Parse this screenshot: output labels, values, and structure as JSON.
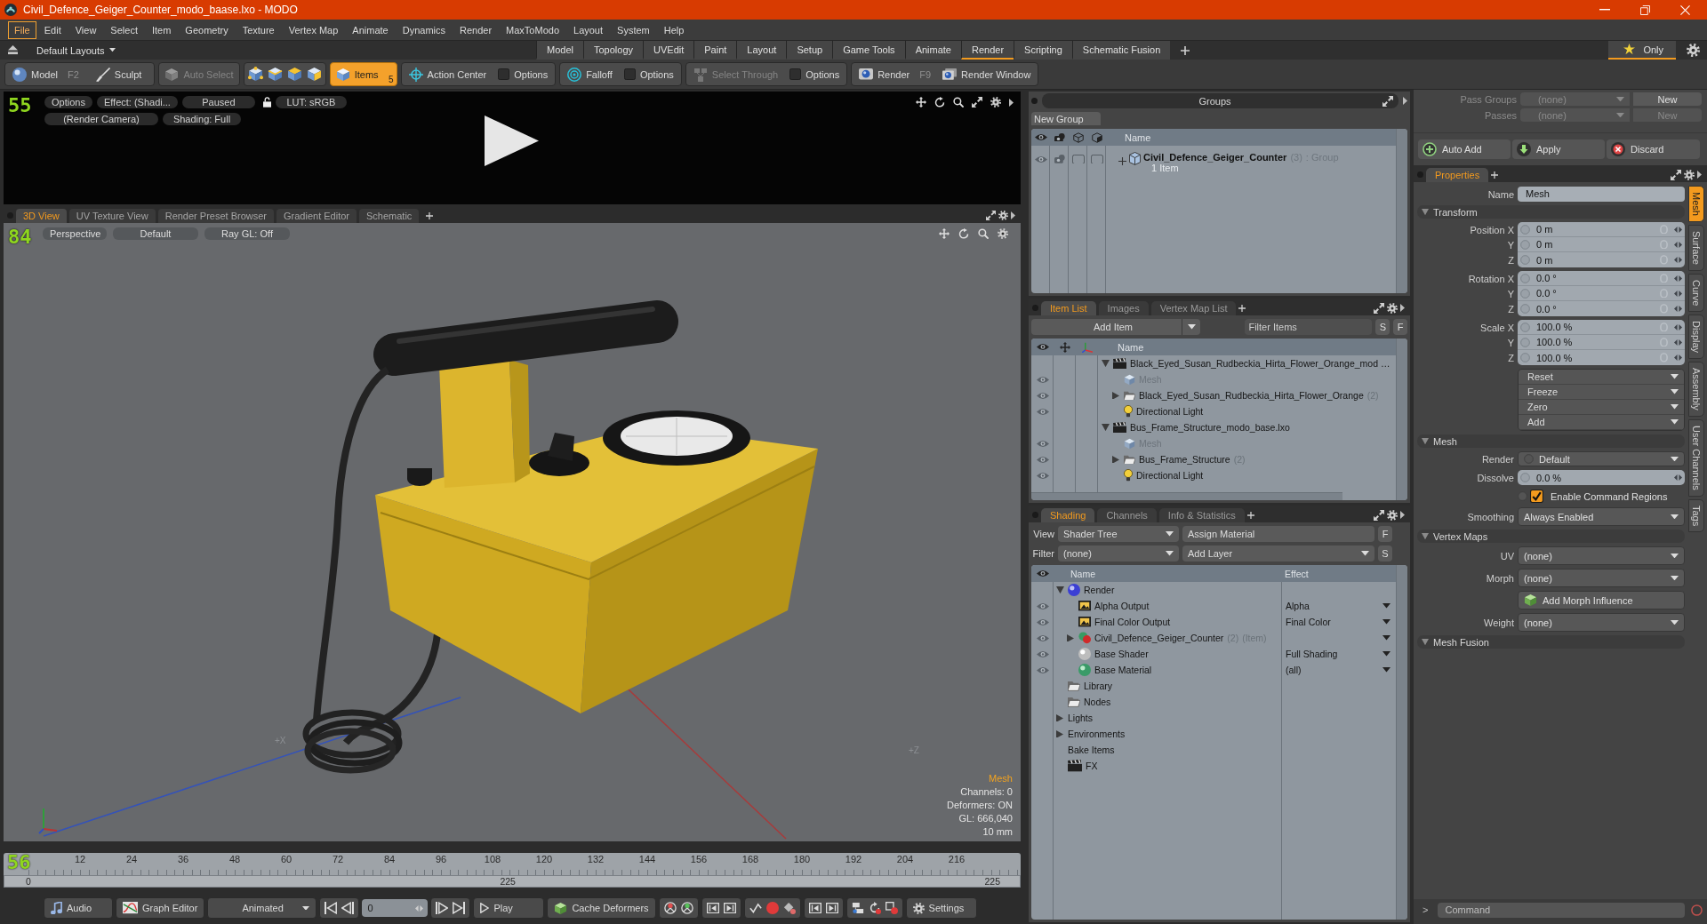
{
  "window": {
    "title": "Civil_Defence_Geiger_Counter_modo_baase.lxo - MODO"
  },
  "menu": [
    {
      "label": "File",
      "selected": true
    },
    {
      "label": "Edit",
      "selected": false
    },
    {
      "label": "View",
      "selected": false
    },
    {
      "label": "Select",
      "selected": false
    },
    {
      "label": "Item",
      "selected": false
    },
    {
      "label": "Geometry",
      "selected": false
    },
    {
      "label": "Texture",
      "selected": false
    },
    {
      "label": "Vertex Map",
      "selected": false
    },
    {
      "label": "Animate",
      "selected": false
    },
    {
      "label": "Dynamics",
      "selected": false
    },
    {
      "label": "Render",
      "selected": false
    },
    {
      "label": "MaxToModo",
      "selected": false
    },
    {
      "label": "Layout",
      "selected": false
    },
    {
      "label": "System",
      "selected": false
    },
    {
      "label": "Help",
      "selected": false
    }
  ],
  "layout_bar": {
    "layouts": "Default Layouts",
    "tabs": [
      {
        "label": "Model",
        "selected": false
      },
      {
        "label": "Topology",
        "selected": false
      },
      {
        "label": "UVEdit",
        "selected": false
      },
      {
        "label": "Paint",
        "selected": false
      },
      {
        "label": "Layout",
        "selected": false
      },
      {
        "label": "Setup",
        "selected": false
      },
      {
        "label": "Game Tools",
        "selected": false
      },
      {
        "label": "Animate",
        "selected": false
      },
      {
        "label": "Render",
        "selected": true
      },
      {
        "label": "Scripting",
        "selected": false
      },
      {
        "label": "Schematic Fusion",
        "selected": false
      }
    ],
    "only": {
      "label": "Only",
      "selected": true
    }
  },
  "toolbar": [
    {
      "items": [
        {
          "kind": "button",
          "label": "Model",
          "hint": "F2",
          "selected": false,
          "disabled": false
        },
        {
          "kind": "button",
          "label": "Sculpt",
          "selected": false,
          "disabled": false
        }
      ]
    },
    {
      "items": [
        {
          "kind": "button",
          "label": "Auto Select",
          "selected": false,
          "disabled": true
        }
      ]
    },
    {
      "items": [
        {
          "kind": "icon",
          "selected": false,
          "disabled": false
        },
        {
          "kind": "icon",
          "selected": false,
          "disabled": false
        },
        {
          "kind": "icon",
          "selected": false,
          "disabled": false
        },
        {
          "kind": "icon",
          "selected": false,
          "disabled": false
        }
      ]
    },
    {
      "items": [
        {
          "kind": "button",
          "label": "Items",
          "badge": "5",
          "selected": true,
          "disabled": false
        }
      ]
    },
    {
      "items": [
        {
          "kind": "button",
          "label": "Action Center",
          "selected": false,
          "disabled": false
        },
        {
          "kind": "toggle",
          "label": "Options",
          "checked": false,
          "selected": false,
          "disabled": false
        }
      ]
    },
    {
      "items": [
        {
          "kind": "button",
          "label": "Falloff",
          "selected": false,
          "disabled": false
        },
        {
          "kind": "toggle",
          "label": "Options",
          "checked": false,
          "selected": false,
          "disabled": false
        }
      ]
    },
    {
      "items": [
        {
          "kind": "button",
          "label": "Select Through",
          "selected": false,
          "disabled": true
        },
        {
          "kind": "toggle",
          "label": "Options",
          "checked": false,
          "selected": false,
          "disabled": false
        }
      ]
    },
    {
      "items": [
        {
          "kind": "button",
          "label": "Render",
          "hint": "F9",
          "selected": false,
          "disabled": false
        },
        {
          "kind": "button",
          "label": "Render Window",
          "selected": false,
          "disabled": false
        }
      ]
    }
  ],
  "preview": {
    "fps_overlay": "55",
    "controls": [
      "Options",
      "Effect: (Shadi...",
      "Paused",
      "LUT: sRGB"
    ],
    "camera": "(Render Camera)",
    "shading": "Shading: Full"
  },
  "viewport": {
    "tabs": [
      {
        "label": "3D View",
        "selected": true
      },
      {
        "label": "UV Texture View",
        "selected": false
      },
      {
        "label": "Render Preset Browser",
        "selected": false
      },
      {
        "label": "Gradient Editor",
        "selected": false
      },
      {
        "label": "Schematic",
        "selected": false
      }
    ],
    "fps_overlay": "84",
    "view_buttons": [
      "Perspective",
      "Default",
      "Ray GL: Off"
    ],
    "axis_labels": [
      "+X",
      "+Z"
    ],
    "info_title": "Mesh",
    "info_lines": [
      "Channels: 0",
      "Deformers: ON",
      "GL: 666,040",
      "10 mm"
    ]
  },
  "timeline": {
    "fps_overlay": "56",
    "ticks": [
      "12",
      "24",
      "36",
      "48",
      "60",
      "72",
      "84",
      "96",
      "108",
      "120",
      "132",
      "144",
      "156",
      "168",
      "180",
      "192",
      "204",
      "216"
    ],
    "range_start": "0",
    "range_middle": "225",
    "range_end": "225"
  },
  "transport": {
    "audio": "Audio",
    "graph_editor": "Graph Editor",
    "mode": "Animated",
    "frame": "0",
    "play": "Play",
    "cache": "Cache Deformers",
    "settings": "Settings"
  },
  "groups": {
    "title": "Groups",
    "new_group": "New Group",
    "column": "Name",
    "rows": [
      {
        "name": "Civil_Defence_Geiger_Counter",
        "count": "(3)",
        "type": ": Group",
        "members": "1 Item",
        "expanded": false
      }
    ]
  },
  "item_list": {
    "tabs": [
      {
        "label": "Item List",
        "selected": true
      },
      {
        "label": "Images",
        "selected": false
      },
      {
        "label": "Vertex Map List",
        "selected": false
      }
    ],
    "add_item": "Add Item",
    "filter": {
      "placeholder": "Filter Items"
    },
    "buttons": [
      "S",
      "F"
    ],
    "column": "Name",
    "items": [
      {
        "kind": "scene",
        "name": "Black_Eyed_Susan_Rudbeckia_Hirta_Flower_Orange_mod …",
        "expanded": true,
        "disabled": false,
        "children": [
          {
            "kind": "mesh",
            "name": "Mesh",
            "disabled": true
          },
          {
            "kind": "group",
            "name": "Black_Eyed_Susan_Rudbeckia_Hirta_Flower_Orange",
            "count": "(2)",
            "expanded": false,
            "disabled": false
          },
          {
            "kind": "light",
            "name": "Directional Light",
            "disabled": false
          }
        ]
      },
      {
        "kind": "scene",
        "name": "Bus_Frame_Structure_modo_base.lxo",
        "expanded": true,
        "disabled": false,
        "children": [
          {
            "kind": "mesh",
            "name": "Mesh",
            "disabled": true
          },
          {
            "kind": "group",
            "name": "Bus_Frame_Structure",
            "count": "(2)",
            "expanded": false,
            "disabled": false
          },
          {
            "kind": "light",
            "name": "Directional Light",
            "disabled": false
          }
        ]
      }
    ]
  },
  "shading": {
    "tabs": [
      {
        "label": "Shading",
        "selected": true
      },
      {
        "label": "Channels",
        "selected": false
      },
      {
        "label": "Info & Statistics",
        "selected": false
      }
    ],
    "view_label": "View",
    "view": "Shader Tree",
    "assign": "Assign Material",
    "filter_label": "Filter",
    "filter": "(none)",
    "add_layer": "Add Layer",
    "buttons": [
      "F",
      "S"
    ],
    "columns": [
      "Name",
      "Effect"
    ],
    "items": [
      {
        "kind": "render",
        "name": "Render",
        "expanded": true,
        "children": [
          {
            "kind": "output",
            "name": "Alpha Output",
            "effect": "Alpha"
          },
          {
            "kind": "output",
            "name": "Final Color Output",
            "effect": "Final Color"
          },
          {
            "kind": "mask",
            "name": "Civil_Defence_Geiger_Counter",
            "count": "(2)",
            "note": "(Item)",
            "expanded": false
          },
          {
            "kind": "shader",
            "name": "Base Shader",
            "effect": "Full Shading"
          },
          {
            "kind": "material",
            "name": "Base Material",
            "effect": "(all)"
          }
        ]
      },
      {
        "kind": "folder",
        "name": "Library"
      },
      {
        "kind": "folder",
        "name": "Nodes"
      },
      {
        "kind": "group",
        "name": "Lights",
        "expanded": false
      },
      {
        "kind": "group",
        "name": "Environments",
        "expanded": false
      },
      {
        "kind": "group",
        "name": "Bake Items"
      },
      {
        "kind": "fx",
        "name": "FX"
      }
    ]
  },
  "passes": [
    {
      "label": "Pass Groups",
      "value": "(none)",
      "button": "New",
      "disabled": false
    },
    {
      "label": "Passes",
      "value": "(none)",
      "button": "New",
      "disabled": true
    }
  ],
  "actions": [
    "Auto Add",
    "Apply",
    "Discard"
  ],
  "properties": {
    "tabs": [
      {
        "label": "Properties",
        "selected": true
      }
    ],
    "name_label": "Name",
    "name": "Mesh",
    "sections": [
      {
        "title": "Transform",
        "expanded": true,
        "rows": [
          {
            "kind": "vector",
            "rows": [
              {
                "label": "Position X",
                "value": "0 m"
              },
              {
                "label": "Y",
                "value": "0 m"
              },
              {
                "label": "Z",
                "value": "0 m"
              }
            ]
          },
          {
            "kind": "vector",
            "rows": [
              {
                "label": "Rotation X",
                "value": "0.0 °"
              },
              {
                "label": "Y",
                "value": "0.0 °"
              },
              {
                "label": "Z",
                "value": "0.0 °"
              }
            ]
          },
          {
            "kind": "vector",
            "rows": [
              {
                "label": "Scale X",
                "value": "100.0 %"
              },
              {
                "label": "Y",
                "value": "100.0 %"
              },
              {
                "label": "Z",
                "value": "100.0 %"
              }
            ]
          },
          {
            "kind": "menu",
            "items": [
              "Reset",
              "Freeze",
              "Zero",
              "Add"
            ]
          }
        ]
      },
      {
        "title": "Mesh",
        "expanded": true,
        "rows": [
          {
            "kind": "channel_dropdown",
            "label": "Render",
            "value": "Default"
          },
          {
            "kind": "number",
            "label": "Dissolve",
            "value": "0.0 %"
          },
          {
            "kind": "checkbox",
            "label": "Enable Command Regions",
            "checked": true
          },
          {
            "kind": "dropdown",
            "label": "Smoothing",
            "value": "Always Enabled"
          }
        ]
      },
      {
        "title": "Vertex Maps",
        "expanded": true,
        "rows": [
          {
            "kind": "dropdown",
            "label": "UV",
            "value": "(none)"
          },
          {
            "kind": "dropdown",
            "label": "Morph",
            "value": "(none)"
          },
          {
            "kind": "button",
            "label": "Add Morph Influence"
          },
          {
            "kind": "dropdown",
            "label": "Weight",
            "value": "(none)"
          }
        ]
      },
      {
        "title": "Mesh Fusion",
        "expanded": true
      }
    ],
    "side_tabs": [
      {
        "label": "Mesh",
        "selected": true
      },
      {
        "label": "Surface",
        "selected": false
      },
      {
        "label": "Curve",
        "selected": false
      },
      {
        "label": "Display",
        "selected": false
      },
      {
        "label": "Assembly",
        "selected": false
      },
      {
        "label": "User Channels",
        "selected": false
      },
      {
        "label": "Tags",
        "selected": false
      }
    ]
  },
  "command": {
    "prompt": ">",
    "placeholder": "Command"
  }
}
